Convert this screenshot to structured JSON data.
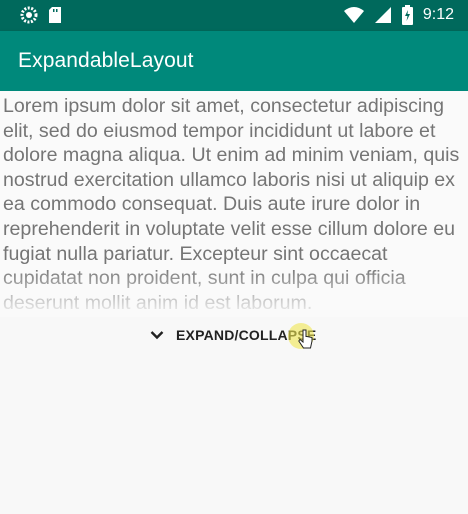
{
  "status_bar": {
    "time": "9:12",
    "icons": [
      "settings-icon",
      "sd-card-icon",
      "wifi-icon",
      "signal-icon",
      "battery-charging-icon"
    ]
  },
  "app_bar": {
    "title": "ExpandableLayout"
  },
  "content": {
    "text": "Lorem ipsum dolor sit amet, consectetur adipiscing elit, sed do eiusmod tempor incididunt ut labore et dolore magna aliqua. Ut enim ad minim veniam, quis nostrud exercitation ullamco laboris nisi ut aliquip ex ea commodo consequat. Duis aute irure dolor in reprehenderit in voluptate velit esse cillum dolore eu fugiat nulla pariatur. Excepteur sint occaecat cupidatat non proident, sunt in culpa qui officia deserunt mollit anim id est laborum."
  },
  "toggle": {
    "label": "EXPAND/COLLAPSE",
    "icon": "chevron-down-icon"
  },
  "colors": {
    "status_bar": "#00695c",
    "app_bar": "#00897b",
    "body_text": "#757575"
  }
}
